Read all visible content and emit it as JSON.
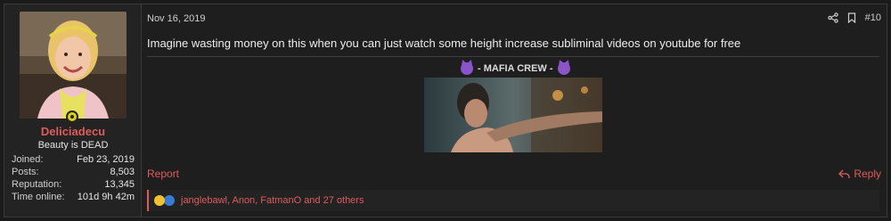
{
  "user": {
    "name": "Deliciadecu",
    "title": "Beauty is DEAD",
    "stats": [
      {
        "label": "Joined:",
        "value": "Feb 23, 2019"
      },
      {
        "label": "Posts:",
        "value": "8,503"
      },
      {
        "label": "Reputation:",
        "value": "13,345"
      },
      {
        "label": "Time online:",
        "value": "101d 9h 42m"
      }
    ]
  },
  "post": {
    "date": "Nov 16, 2019",
    "number": "#10",
    "message": "Imagine wasting money on this when you can just watch some height increase subliminal videos on youtube for free",
    "signature_title": "- MAFIA CREW -",
    "report_label": "Report",
    "reply_label": "Reply",
    "reactions_text": "janglebawl, Anon, FatmanO and 27 others"
  },
  "colors": {
    "accent": "#e05b5b",
    "online": "#d7d11c",
    "background": "#1e1e1e"
  },
  "icons": {
    "share": "share-icon",
    "bookmark": "bookmark-icon",
    "reply": "reply-icon",
    "online": "online-status-icon",
    "signature": "devil-emoji-icon"
  }
}
